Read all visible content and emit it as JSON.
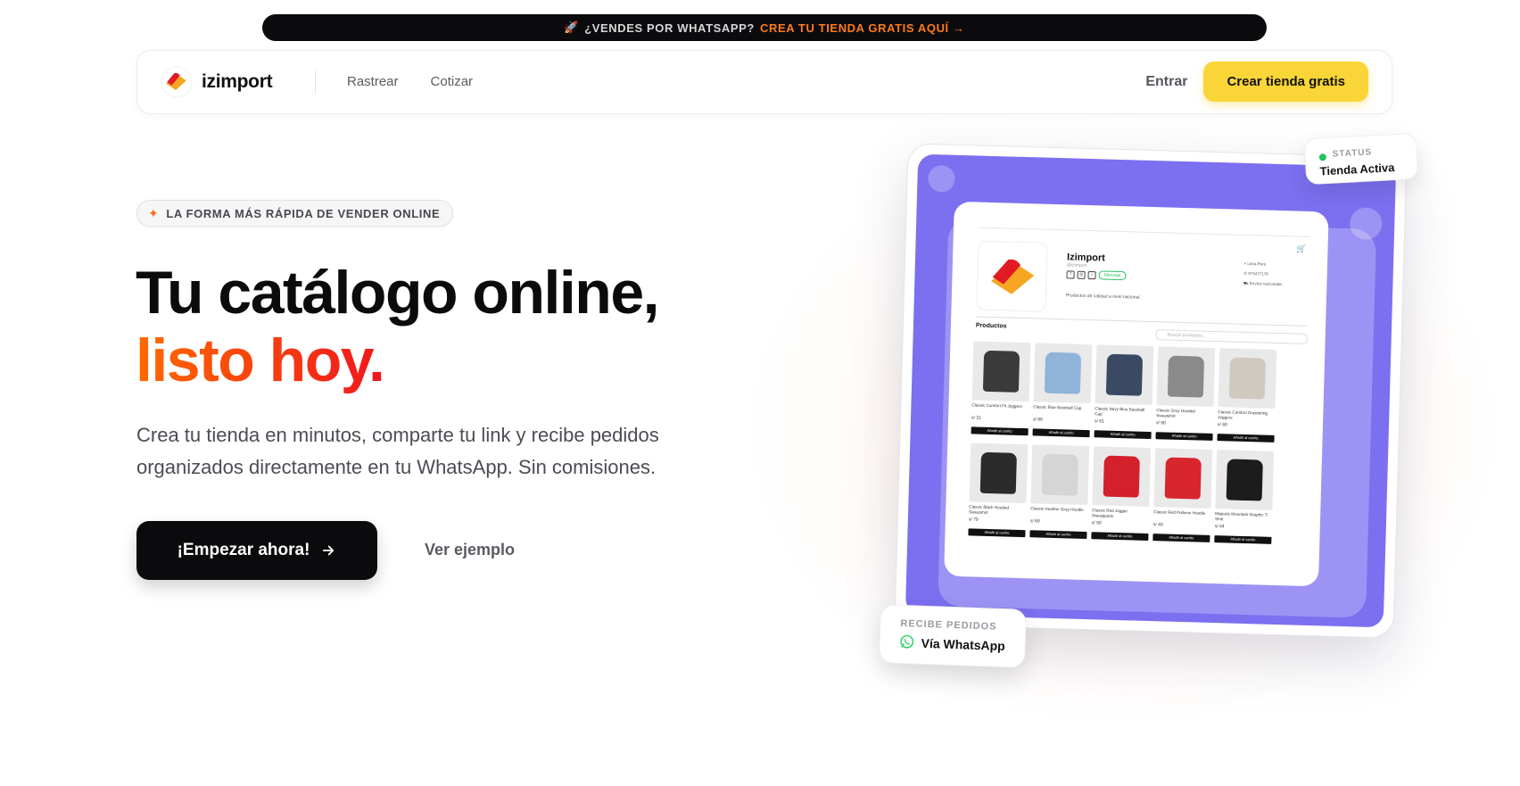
{
  "announcement": {
    "icon": "rocket-icon",
    "text": "¿VENDES POR WHATSAPP?",
    "cta": "CREA TU TIENDA GRATIS AQUÍ →",
    "cta_color": "#ff7a1a"
  },
  "navbar": {
    "brand": "izimport",
    "links": [
      "Rastrear",
      "Cotizar"
    ],
    "login": "Entrar",
    "cta": "Crear tienda gratis",
    "cta_color": "#fad537"
  },
  "hero": {
    "badge": "LA FORMA MÁS RÁPIDA DE VENDER ONLINE",
    "headline_line1": "Tu catálogo online,",
    "headline_line2": "listo hoy.",
    "subtitle": "Crea tu tienda en minutos, comparte tu link y recibe pedidos organizados directamente en tu WhatsApp. Sin comisiones.",
    "primary_button": "¡Empezar ahora!",
    "secondary_button": "Ver ejemplo",
    "gradient_colors": [
      "#ff6a00",
      "#f0171e"
    ]
  },
  "status_card": {
    "label": "STATUS",
    "value": "Tienda Activa",
    "dot_color": "#23c25a"
  },
  "whatsapp_card": {
    "label": "RECIBE PEDIDOS",
    "value": "Vía WhatsApp"
  },
  "mockup": {
    "screen_color": "#7c6ff0",
    "store_name": "Izimport",
    "store_handle": "@izimport",
    "whatsapp_pill": "Mensaje",
    "store_description": "Productos de calidad a nivel nacional.",
    "info": [
      "Lima-Perú",
      "973477176",
      "Envíos nacionales"
    ],
    "products_title": "Productos",
    "search_placeholder": "Buscar productos...",
    "add_label": "Añadir al carrito",
    "products": [
      {
        "name": "Classic Comfort Fit Joggers",
        "price": "s/ 21",
        "color": "#3a3a3a"
      },
      {
        "name": "Classic Blue Baseball Cap",
        "price": "s/ 86",
        "color": "#8fb3d9"
      },
      {
        "name": "Classic Navy Blue Baseball Cap",
        "price": "s/ 61",
        "color": "#3b4a63"
      },
      {
        "name": "Classic Grey Hooded Sweatshirt",
        "price": "s/ 90",
        "color": "#8a8a8a"
      },
      {
        "name": "Classic Comfort Drawstring Joggers",
        "price": "s/ 60",
        "color": "#cfc9c0"
      },
      {
        "name": "Classic Black Hooded Sweatshirt",
        "price": "s/ 79",
        "color": "#2b2b2b"
      },
      {
        "name": "Classic Heather Gray Hoodie",
        "price": "s/ 69",
        "color": "#d5d5d5"
      },
      {
        "name": "Classic Red Jogger Sweatpants",
        "price": "s/ 50",
        "color": "#d4202a"
      },
      {
        "name": "Classic Red Pullover Hoodie",
        "price": "s/ 40",
        "color": "#d8262c"
      },
      {
        "name": "Majestic Mountain Graphic T-Shirt",
        "price": "s/ 44",
        "color": "#1c1c1c"
      }
    ]
  }
}
